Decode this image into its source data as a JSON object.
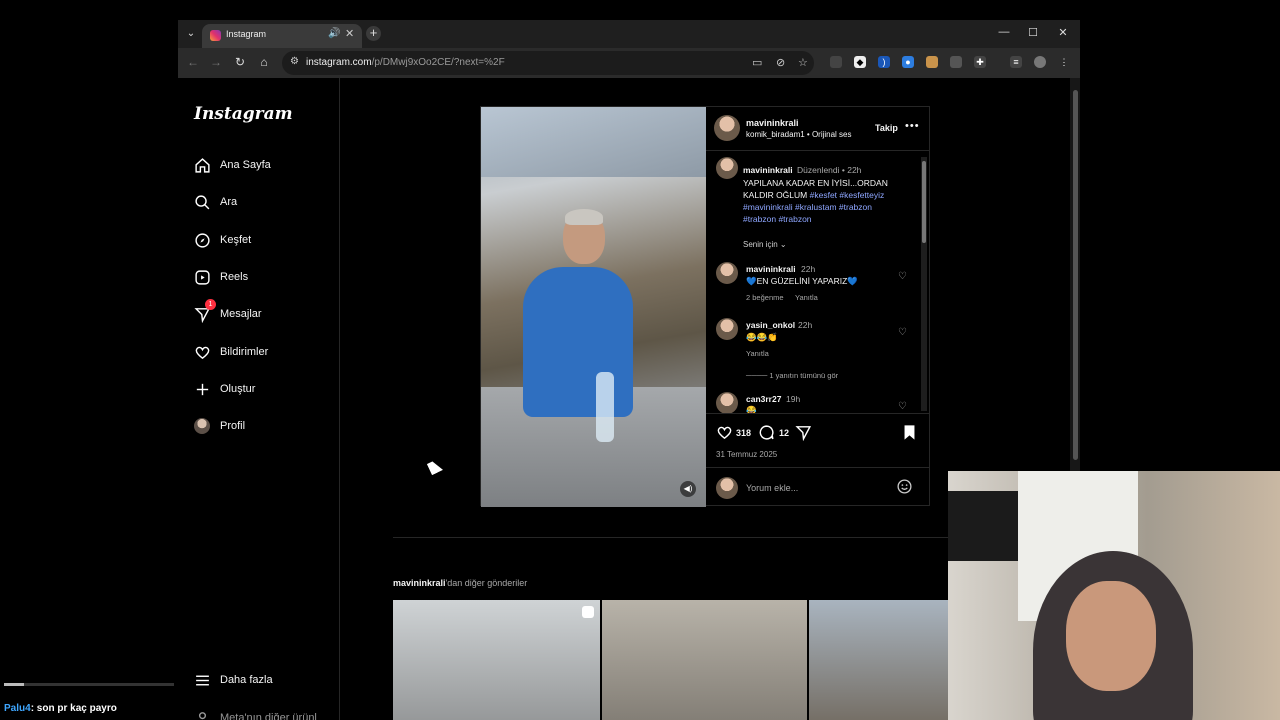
{
  "browser": {
    "tab_title": "Instagram",
    "url_host": "instagram.com",
    "url_path": "/p/DMwj9xOo2CE/?next=%2F"
  },
  "sidebar": {
    "logo": "Instagram",
    "items": [
      {
        "label": "Ana Sayfa",
        "icon": "home-icon"
      },
      {
        "label": "Ara",
        "icon": "search-icon"
      },
      {
        "label": "Keşfet",
        "icon": "explore-icon"
      },
      {
        "label": "Reels",
        "icon": "reels-icon"
      },
      {
        "label": "Mesajlar",
        "icon": "messages-icon",
        "badge": "1"
      },
      {
        "label": "Bildirimler",
        "icon": "heart-icon"
      },
      {
        "label": "Oluştur",
        "icon": "plus-icon"
      },
      {
        "label": "Profil",
        "icon": "avatar"
      }
    ],
    "more_label": "Daha fazla",
    "meta_label": "Meta'nın diğer ürünl"
  },
  "post": {
    "author": "mavininkrali",
    "audio": "komik_biradam1 • Orijinal ses",
    "follow_label": "Takip",
    "caption": {
      "user": "mavininkrali",
      "meta": "Düzenlendi • 22h",
      "text": "YAPILANA KADAR EN İYİSİ...ORDAN KALDIR OĞLUM",
      "tags": "#kesfet #kesfetteyiz #mavininkrali #kralustam #trabzon #trabzon #trabzon"
    },
    "sort_label": "Senin için",
    "comments": [
      {
        "user": "mavininkrali",
        "time": "22h",
        "text": "💙EN GÜZELİNİ YAPARIZ💙",
        "likes": "2 beğenme",
        "reply": "Yanıtla"
      },
      {
        "user": "yasin_onkol",
        "time": "22h",
        "text": "😂😂👏",
        "reply": "Yanıtla",
        "view_replies": "1 yanıtın tümünü gör"
      },
      {
        "user": "can3rr27",
        "time": "19h",
        "text": "😂"
      }
    ],
    "like_count": "318",
    "comment_count": "12",
    "date": "31 Temmuz 2025",
    "comment_placeholder": "Yorum ekle..."
  },
  "more_posts": {
    "user": "mavininkrali",
    "suffix": "'dan diğer gönderiler"
  },
  "overlay": {
    "chat_user": "Palu4",
    "chat_text": ": son pr kaç payro"
  }
}
